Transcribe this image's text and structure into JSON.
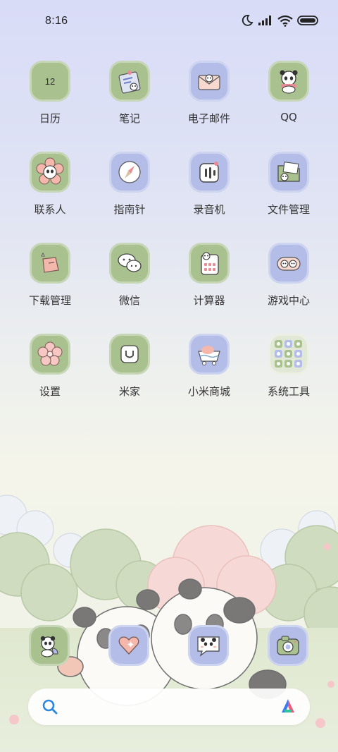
{
  "status_bar": {
    "time": "8:16",
    "icons": [
      "moon-icon",
      "signal-icon",
      "wifi-icon",
      "battery-icon"
    ]
  },
  "apps": [
    {
      "label": "日历",
      "icon": "calendar-icon",
      "badge_text": "12",
      "tile": "green"
    },
    {
      "label": "笔记",
      "icon": "notes-icon",
      "tile": "green"
    },
    {
      "label": "电子邮件",
      "icon": "email-icon",
      "tile": "blue"
    },
    {
      "label": "QQ",
      "icon": "qq-icon",
      "tile": "green"
    },
    {
      "label": "联系人",
      "icon": "contacts-icon",
      "tile": "green"
    },
    {
      "label": "指南针",
      "icon": "compass-icon",
      "tile": "blue"
    },
    {
      "label": "录音机",
      "icon": "recorder-icon",
      "tile": "blue"
    },
    {
      "label": "文件管理",
      "icon": "file-manager-icon",
      "tile": "blue"
    },
    {
      "label": "下载管理",
      "icon": "download-icon",
      "tile": "green"
    },
    {
      "label": "微信",
      "icon": "wechat-icon",
      "tile": "green"
    },
    {
      "label": "计算器",
      "icon": "calculator-icon",
      "tile": "green"
    },
    {
      "label": "游戏中心",
      "icon": "game-center-icon",
      "tile": "blue"
    },
    {
      "label": "设置",
      "icon": "settings-flower-icon",
      "tile": "green"
    },
    {
      "label": "米家",
      "icon": "mijia-icon",
      "tile": "green"
    },
    {
      "label": "小米商城",
      "icon": "mi-store-icon",
      "tile": "blue"
    },
    {
      "label": "系统工具",
      "icon": "system-tools-folder-icon",
      "tile": "pale"
    }
  ],
  "dock": [
    {
      "icon": "panda-phone-icon",
      "tile": "green"
    },
    {
      "icon": "heart-message-icon",
      "tile": "blue"
    },
    {
      "icon": "panda-browser-icon",
      "tile": "blue"
    },
    {
      "icon": "camera-icon",
      "tile": "blue"
    }
  ],
  "search_bar": {
    "icons": [
      "search-icon",
      "assistant-logo-icon"
    ]
  },
  "colors": {
    "tile_green": "#a9c18f",
    "tile_blue": "#b3bde8",
    "tile_pale": "#e2e8d6",
    "label_text": "#333333"
  }
}
